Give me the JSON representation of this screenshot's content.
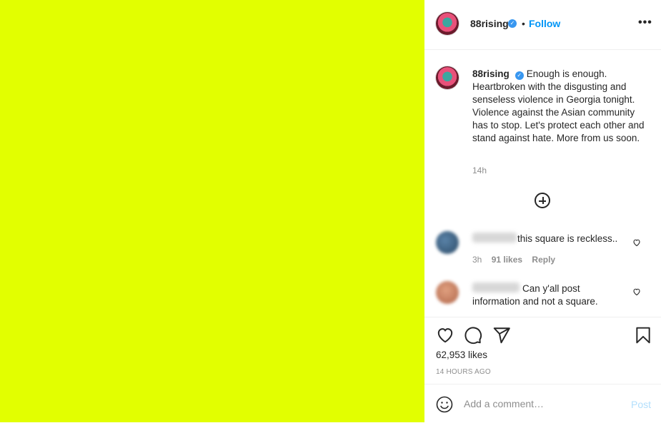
{
  "post": {
    "image_color": "#e2ff00",
    "username": "88rising",
    "verified_icon": "verified-badge-icon",
    "separator": "•",
    "follow_label": "Follow",
    "more_icon": "more-options-icon",
    "more_label": "•••"
  },
  "caption": {
    "username": "88rising",
    "text": "Enough is enough. Heartbroken with the disgusting and senseless violence in Georgia tonight. Violence against the Asian community has to stop. Let's protect each other and stand against hate. More from us soon.",
    "time": "14h"
  },
  "load_more_icon": "plus-circle-icon",
  "comments": [
    {
      "text": "this square is reckless..",
      "time": "3h",
      "likes": "91 likes",
      "reply": "Reply"
    },
    {
      "text_line1": "Can y'all post",
      "text_line2": "information and not a square."
    }
  ],
  "actions": {
    "like_icon": "heart-icon",
    "comment_icon": "comment-icon",
    "share_icon": "paper-plane-icon",
    "save_icon": "bookmark-icon",
    "likes": "62,953 likes",
    "timeago": "14 HOURS AGO"
  },
  "comment_box": {
    "emoji_icon": "emoji-icon",
    "placeholder": "Add a comment…",
    "post_label": "Post"
  },
  "colors": {
    "accent": "#0095f6",
    "text": "#262626",
    "muted": "#8e8e8e",
    "post_disabled": "#b2dffc"
  }
}
